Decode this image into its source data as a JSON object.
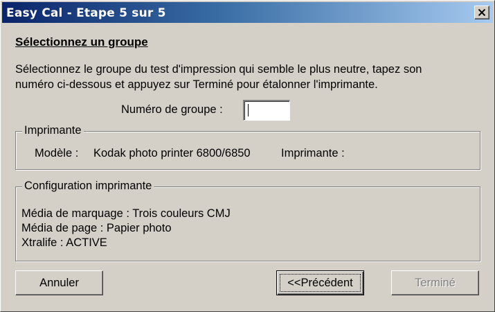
{
  "window": {
    "title": "Easy Cal - Etape 5 sur 5",
    "close_icon": "close-x-icon"
  },
  "heading": "Sélectionnez un groupe",
  "instructions": {
    "line1": "Sélectionnez le groupe du test d'impression qui semble le plus neutre, tapez son",
    "line2": "numéro ci-dessous et appuyez sur Terminé pour étalonner l'imprimante."
  },
  "group_number": {
    "label": "Numéro de groupe :",
    "value": ""
  },
  "printer_group": {
    "legend": "Imprimante",
    "model_label": "Modèle :",
    "model_value": "Kodak photo printer 6800/6850",
    "printer_label": "Imprimante :"
  },
  "config_group": {
    "legend": "Configuration imprimante",
    "lines": [
      "Média de marquage : Trois couleurs CMJ",
      "Média de page : Papier photo",
      "Xtralife : ACTIVE"
    ]
  },
  "buttons": {
    "cancel": "Annuler",
    "previous": "<<Précédent",
    "finish": "Terminé"
  },
  "colors": {
    "face": "#d4d0c8",
    "title_start": "#0a246a",
    "title_end": "#a6caf0",
    "disabled_text": "#808080"
  }
}
